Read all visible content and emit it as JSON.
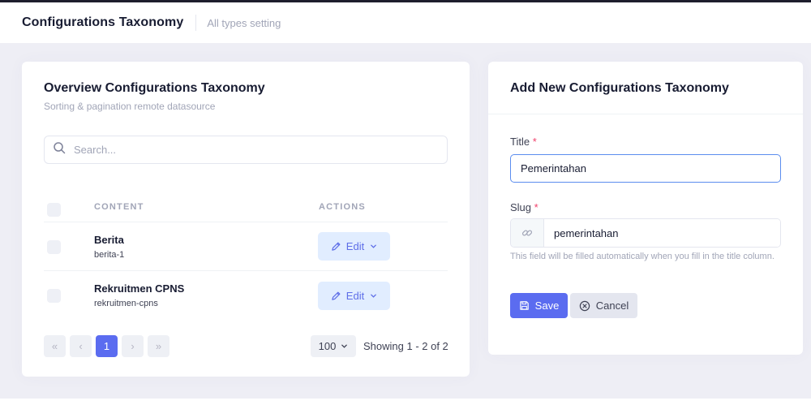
{
  "header": {
    "title": "Configurations Taxonomy",
    "subtitle": "All types setting"
  },
  "overview": {
    "title": "Overview Configurations Taxonomy",
    "subtitle": "Sorting & pagination remote datasource",
    "search": {
      "placeholder": "Search...",
      "value": ""
    },
    "columns": {
      "content": "CONTENT",
      "actions": "ACTIONS"
    },
    "rows": [
      {
        "title": "Berita",
        "slug": "berita-1",
        "action_label": "Edit"
      },
      {
        "title": "Rekruitmen CPNS",
        "slug": "rekruitmen-cpns",
        "action_label": "Edit"
      }
    ],
    "pagination": {
      "first": "«",
      "prev": "‹",
      "current_page": "1",
      "next": "›",
      "last": "»",
      "per_page": "100",
      "showing": "Showing 1 - 2 of 2"
    }
  },
  "form": {
    "title": "Add New Configurations Taxonomy",
    "title_field": {
      "label": "Title",
      "required_mark": "*",
      "value": "Pemerintahan"
    },
    "slug_field": {
      "label": "Slug",
      "required_mark": "*",
      "value": "pemerintahan",
      "help": "This field will be filled automatically when you fill in the title column."
    },
    "save_label": "Save",
    "cancel_label": "Cancel"
  },
  "colors": {
    "primary": "#5b6cf0",
    "edit_bg": "#e1edff",
    "required": "#f1416c",
    "page_bg": "#eeeef5"
  },
  "icons": {
    "search": "search-icon",
    "pencil": "pencil-icon",
    "chevron": "chevron-down-icon",
    "link": "link-icon",
    "save": "floppy-disk-icon",
    "cancel": "close-circle-icon"
  }
}
